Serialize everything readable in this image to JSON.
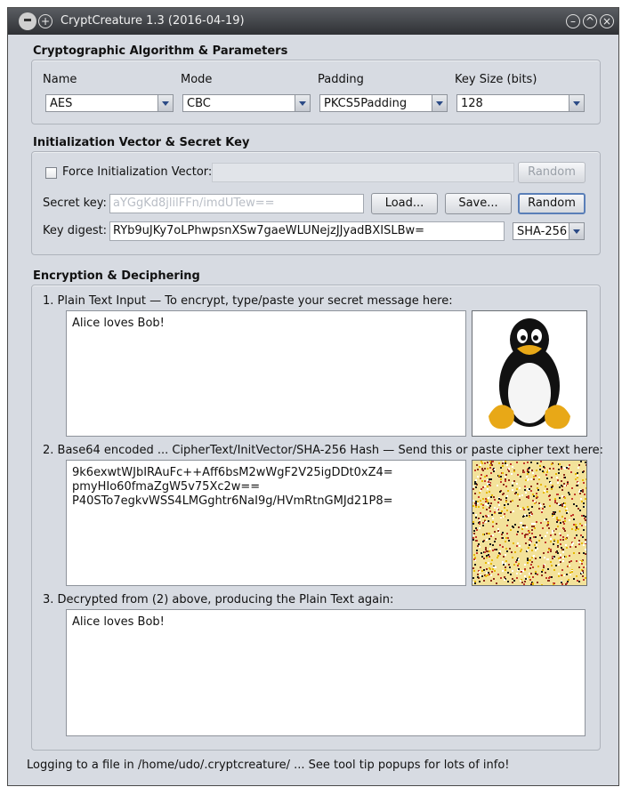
{
  "window": {
    "title": "CryptCreature 1.3 (2016-04-19)",
    "icons": [
      "mask-icon",
      "add-icon",
      "minimize-icon",
      "maximize-icon",
      "close-icon"
    ]
  },
  "algorithm": {
    "section_title": "Cryptographic Algorithm & Parameters",
    "name_label": "Name",
    "name_value": "AES",
    "mode_label": "Mode",
    "mode_value": "CBC",
    "padding_label": "Padding",
    "padding_value": "PKCS5Padding",
    "keysize_label": "Key Size (bits)",
    "keysize_value": "128"
  },
  "iv": {
    "section_title": "Initialization Vector & Secret Key",
    "force_label": "Force Initialization Vector:",
    "force_checked": false,
    "iv_random_label": "Random",
    "secret_label": "Secret key:",
    "secret_value": "aYGgKd8jlilFFn/imdUTew==",
    "load_label": "Load...",
    "save_label": "Save...",
    "random_label": "Random",
    "digest_label": "Key digest:",
    "digest_value": "RYb9uJKy7oLPhwpsnXSw7gaeWLUNejzJJyadBXISLBw=",
    "digest_algo": "SHA-256"
  },
  "encryption": {
    "section_title": "Encryption & Deciphering",
    "plain_label": "1. Plain Text Input — To encrypt, type/paste your secret message here:",
    "plain_text": "Alice loves Bob!",
    "cipher_label": "2. Base64 encoded ... CipherText/InitVector/SHA-256 Hash — Send this or paste cipher text here:",
    "cipher_text": "9k6exwtWJbIRAuFc++Aff6bsM2wWgF2V25igDDt0xZ4=\npmyHIo60fmaZgW5v75Xc2w==\nP40STo7egkvWSS4LMGghtr6NaI9g/HVmRtnGMJd21P8=",
    "decrypt_label": "3. Decrypted from (2) above, producing the Plain Text again:",
    "decrypt_text": "Alice loves Bob!"
  },
  "status": "Logging to a file in /home/udo/.cryptcreature/ ... See tool tip popups for lots of info!"
}
